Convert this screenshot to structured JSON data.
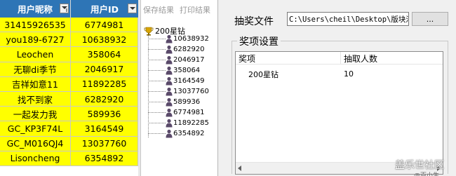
{
  "sheet": {
    "headers": [
      "用户昵称",
      "用户ID"
    ],
    "rows": [
      [
        "31415926535",
        "6774981"
      ],
      [
        "you189-6727",
        "10638932"
      ],
      [
        "Leochen",
        "358064"
      ],
      [
        "无聊di季节",
        "2046917"
      ],
      [
        "吉祥如意11",
        "11892285"
      ],
      [
        "找不到家",
        "6282920"
      ],
      [
        "一起发力我",
        "589936"
      ],
      [
        "GC_KP3F74L",
        "3164549"
      ],
      [
        "GC_M016QJ4",
        "13037760"
      ],
      [
        "Lisoncheng",
        "6354892"
      ]
    ]
  },
  "tree": {
    "toolbar": [
      "保存结果",
      "打印结果"
    ],
    "root": "200星钻",
    "items": [
      "10638932",
      "6282920",
      "2046917",
      "358064",
      "3164549",
      "13037760",
      "589936",
      "6774981",
      "11892285",
      "6354892"
    ]
  },
  "dialog": {
    "file_label": "抽奖文件",
    "file_path": "C:\\Users\\cheil\\Desktop\\版块活",
    "browse_label": "...",
    "group_title": "奖项设置",
    "columns": [
      "奖项",
      "抽取人数"
    ],
    "rows": [
      {
        "prize": "200星钻",
        "count": "10"
      }
    ]
  },
  "watermark": {
    "main": "盖乐世社区",
    "sub": "@百小生"
  },
  "colors": {
    "header_blue": "#2e75b6",
    "cell_yellow": "#ffff00"
  }
}
